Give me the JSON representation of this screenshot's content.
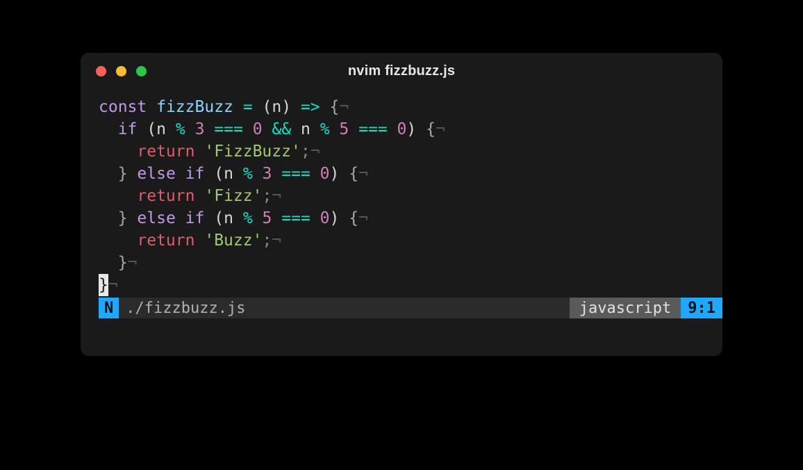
{
  "window": {
    "title": "nvim fizzbuzz.js"
  },
  "code": {
    "lines": [
      {
        "indent": 0,
        "t": [
          [
            "kw",
            "const"
          ],
          [
            "sp",
            " "
          ],
          [
            "fn",
            "fizzBuzz"
          ],
          [
            "sp",
            " "
          ],
          [
            "op",
            "="
          ],
          [
            "sp",
            " "
          ],
          [
            "par",
            "("
          ],
          [
            "par",
            "n"
          ],
          [
            "par",
            ")"
          ],
          [
            "sp",
            " "
          ],
          [
            "op",
            "=>"
          ],
          [
            "sp",
            " "
          ],
          [
            "brace",
            "{"
          ],
          [
            "eol",
            "¬"
          ]
        ]
      },
      {
        "indent": 1,
        "t": [
          [
            "kw",
            "if"
          ],
          [
            "sp",
            " "
          ],
          [
            "par",
            "("
          ],
          [
            "par",
            "n"
          ],
          [
            "sp",
            " "
          ],
          [
            "op",
            "%"
          ],
          [
            "sp",
            " "
          ],
          [
            "num",
            "3"
          ],
          [
            "sp",
            " "
          ],
          [
            "op",
            "==="
          ],
          [
            "sp",
            " "
          ],
          [
            "num",
            "0"
          ],
          [
            "sp",
            " "
          ],
          [
            "op",
            "&&"
          ],
          [
            "sp",
            " "
          ],
          [
            "par",
            "n"
          ],
          [
            "sp",
            " "
          ],
          [
            "op",
            "%"
          ],
          [
            "sp",
            " "
          ],
          [
            "num",
            "5"
          ],
          [
            "sp",
            " "
          ],
          [
            "op",
            "==="
          ],
          [
            "sp",
            " "
          ],
          [
            "num",
            "0"
          ],
          [
            "par",
            ")"
          ],
          [
            "sp",
            " "
          ],
          [
            "brace",
            "{"
          ],
          [
            "eol",
            "¬"
          ]
        ]
      },
      {
        "indent": 2,
        "t": [
          [
            "ret",
            "return"
          ],
          [
            "sp",
            " "
          ],
          [
            "str",
            "'FizzBuzz'"
          ],
          [
            "semi",
            ";"
          ],
          [
            "eol",
            "¬"
          ]
        ]
      },
      {
        "indent": 1,
        "t": [
          [
            "brace",
            "}"
          ],
          [
            "sp",
            " "
          ],
          [
            "kw",
            "else"
          ],
          [
            "sp",
            " "
          ],
          [
            "kw",
            "if"
          ],
          [
            "sp",
            " "
          ],
          [
            "par",
            "("
          ],
          [
            "par",
            "n"
          ],
          [
            "sp",
            " "
          ],
          [
            "op",
            "%"
          ],
          [
            "sp",
            " "
          ],
          [
            "num",
            "3"
          ],
          [
            "sp",
            " "
          ],
          [
            "op",
            "==="
          ],
          [
            "sp",
            " "
          ],
          [
            "num",
            "0"
          ],
          [
            "par",
            ")"
          ],
          [
            "sp",
            " "
          ],
          [
            "brace",
            "{"
          ],
          [
            "eol",
            "¬"
          ]
        ]
      },
      {
        "indent": 2,
        "t": [
          [
            "ret",
            "return"
          ],
          [
            "sp",
            " "
          ],
          [
            "str",
            "'Fizz'"
          ],
          [
            "semi",
            ";"
          ],
          [
            "eol",
            "¬"
          ]
        ]
      },
      {
        "indent": 1,
        "t": [
          [
            "brace",
            "}"
          ],
          [
            "sp",
            " "
          ],
          [
            "kw",
            "else"
          ],
          [
            "sp",
            " "
          ],
          [
            "kw",
            "if"
          ],
          [
            "sp",
            " "
          ],
          [
            "par",
            "("
          ],
          [
            "par",
            "n"
          ],
          [
            "sp",
            " "
          ],
          [
            "op",
            "%"
          ],
          [
            "sp",
            " "
          ],
          [
            "num",
            "5"
          ],
          [
            "sp",
            " "
          ],
          [
            "op",
            "==="
          ],
          [
            "sp",
            " "
          ],
          [
            "num",
            "0"
          ],
          [
            "par",
            ")"
          ],
          [
            "sp",
            " "
          ],
          [
            "brace",
            "{"
          ],
          [
            "eol",
            "¬"
          ]
        ]
      },
      {
        "indent": 2,
        "t": [
          [
            "ret",
            "return"
          ],
          [
            "sp",
            " "
          ],
          [
            "str",
            "'Buzz'"
          ],
          [
            "semi",
            ";"
          ],
          [
            "eol",
            "¬"
          ]
        ]
      },
      {
        "indent": 1,
        "t": [
          [
            "brace",
            "}"
          ],
          [
            "eol",
            "¬"
          ]
        ]
      },
      {
        "indent": 0,
        "t": [
          [
            "cursor",
            "}"
          ],
          [
            "eol",
            "¬"
          ]
        ]
      }
    ]
  },
  "status": {
    "mode": "N",
    "file": "./fizzbuzz.js",
    "lang": "javascript",
    "pos": "9:1"
  },
  "colors": {
    "accent": "#1ea8ff"
  }
}
